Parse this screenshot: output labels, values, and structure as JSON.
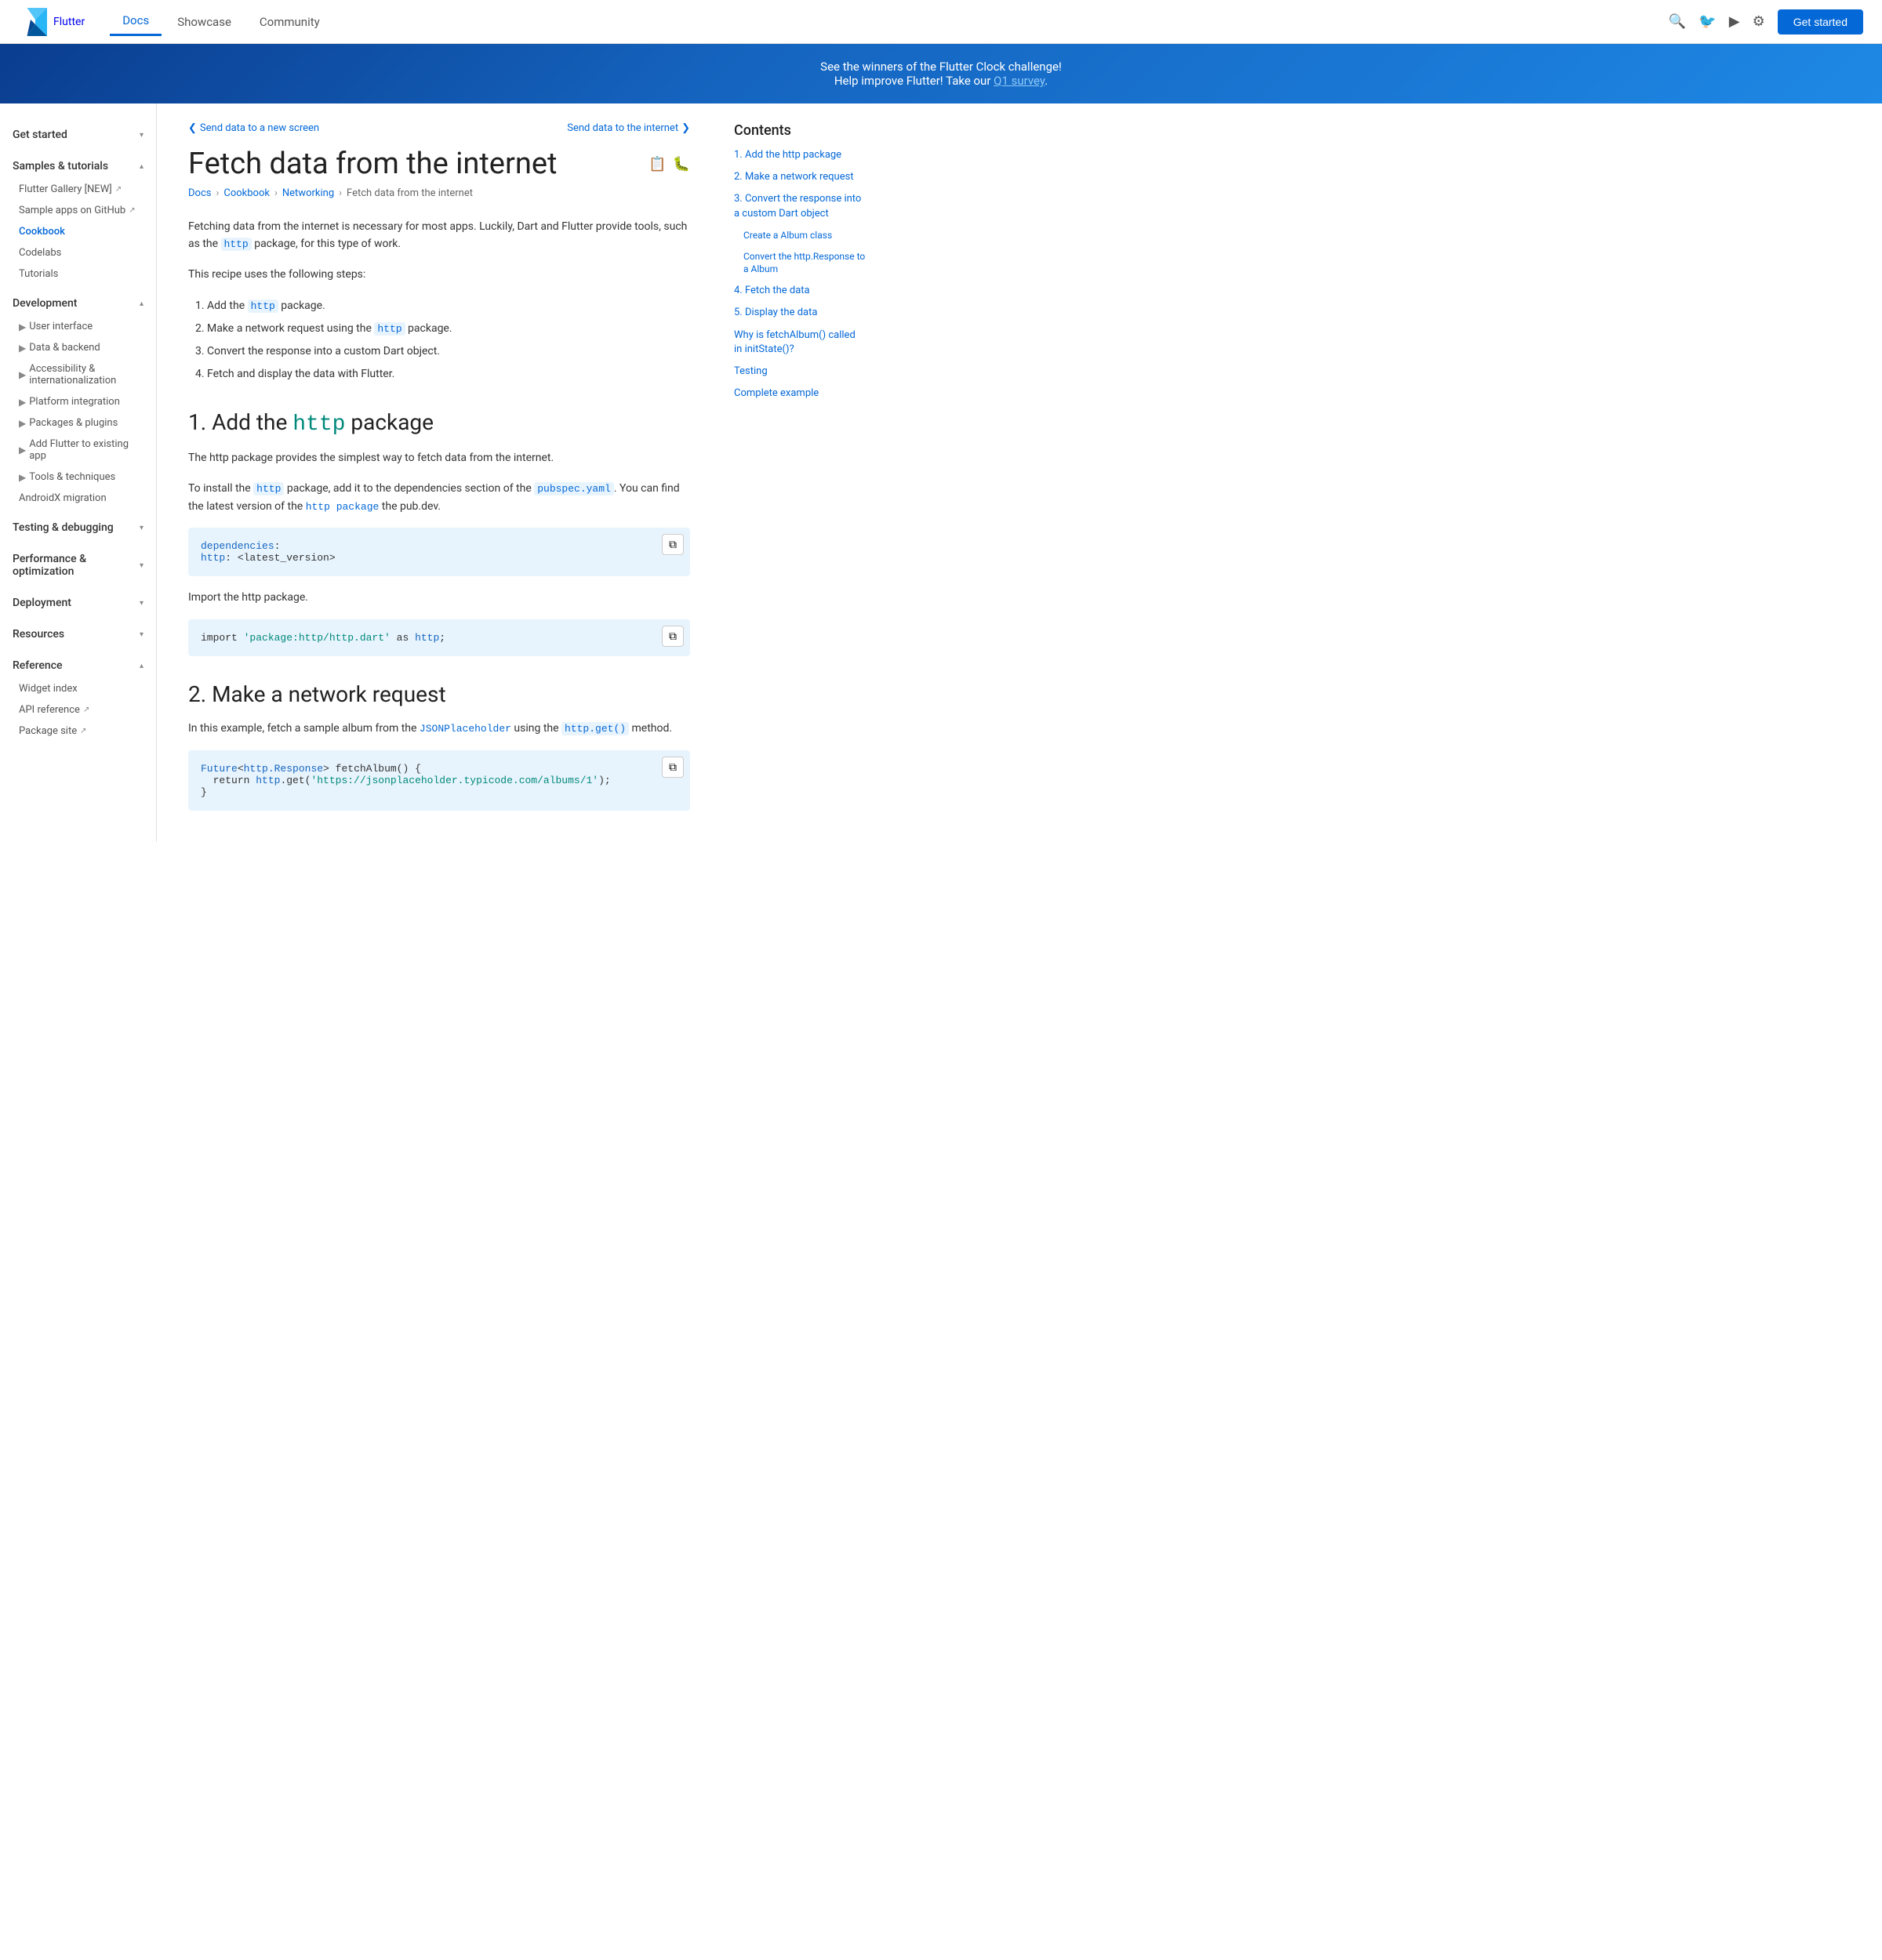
{
  "header": {
    "logo_text": "Flutter",
    "nav_items": [
      {
        "label": "Docs",
        "active": true
      },
      {
        "label": "Showcase",
        "active": false
      },
      {
        "label": "Community",
        "active": false
      }
    ],
    "get_started_label": "Get started"
  },
  "banner": {
    "line1": "See the winners of the Flutter Clock challenge!",
    "line2_prefix": "Help improve Flutter! Take our ",
    "line2_link": "Q1 survey",
    "line2_suffix": "."
  },
  "sidebar": {
    "sections": [
      {
        "label": "Get started",
        "expanded": true,
        "items": []
      },
      {
        "label": "Samples & tutorials",
        "expanded": true,
        "items": [
          {
            "label": "Flutter Gallery [NEW]",
            "external": true,
            "active": false
          },
          {
            "label": "Sample apps on GitHub",
            "external": true,
            "active": false
          },
          {
            "label": "Cookbook",
            "active": true
          },
          {
            "label": "Codelabs",
            "active": false
          },
          {
            "label": "Tutorials",
            "active": false
          }
        ]
      },
      {
        "label": "Development",
        "expanded": true,
        "items": [
          {
            "label": "User interface",
            "hasArrow": true
          },
          {
            "label": "Data & backend",
            "hasArrow": true
          },
          {
            "label": "Accessibility & internationalization",
            "hasArrow": true
          },
          {
            "label": "Platform integration",
            "hasArrow": true
          },
          {
            "label": "Packages & plugins",
            "hasArrow": true
          },
          {
            "label": "Add Flutter to existing app",
            "hasArrow": true
          },
          {
            "label": "Tools & techniques",
            "hasArrow": true
          },
          {
            "label": "AndroidX migration",
            "hasArrow": false
          }
        ]
      },
      {
        "label": "Testing & debugging",
        "expanded": false,
        "items": []
      },
      {
        "label": "Performance & optimization",
        "expanded": false,
        "items": []
      },
      {
        "label": "Deployment",
        "expanded": false,
        "items": []
      },
      {
        "label": "Resources",
        "expanded": false,
        "items": []
      },
      {
        "label": "Reference",
        "expanded": true,
        "items": [
          {
            "label": "Widget index",
            "external": false
          },
          {
            "label": "API reference",
            "external": true
          },
          {
            "label": "Package site",
            "external": true
          }
        ]
      }
    ]
  },
  "page": {
    "prev_link": "Send data to a new screen",
    "next_link": "Send data to the internet",
    "title": "Fetch data from the internet",
    "breadcrumb": [
      "Docs",
      "Cookbook",
      "Networking",
      "Fetch data from the internet"
    ],
    "intro1": "Fetching data from the internet is necessary for most apps. Luckily, Dart and Flutter provide tools, such as the http package, for this type of work.",
    "intro2": "This recipe uses the following steps:",
    "steps": [
      "Add the http package.",
      "Make a network request using the http package.",
      "Convert the response into a custom Dart object.",
      "Fetch and display the data with Flutter."
    ],
    "section1_heading_prefix": "1. Add the ",
    "section1_heading_code": "http",
    "section1_heading_suffix": " package",
    "section1_text1": "The http package provides the simplest way to fetch data from the internet.",
    "section1_text2_prefix": "To install the ",
    "section1_text2_code1": "http",
    "section1_text2_mid": " package, add it to the dependencies section of the ",
    "section1_text2_code2": "pubspec.yaml",
    "section1_text2_suffix": ". You can find the latest version of the ",
    "section1_text2_link": "http package",
    "section1_text2_end": " the pub.dev.",
    "code1_line1_key": "dependencies",
    "code1_line2_key": "  http",
    "code1_line2_val": " <latest_version>",
    "section1_text3": "Import the http package.",
    "code2_line": "import 'package:http/http.dart' as http;",
    "section2_heading": "2. Make a network request",
    "section2_text": "In this example, fetch a sample album from the JSONPlaceholder using the http.get() method.",
    "code3_line1": "Future<http.Response> fetchAlbum() {",
    "code3_line2": "  return http.get('https://jsonplaceholder.typicode.com/albums/1');",
    "code3_line3": "}"
  },
  "contents": {
    "title": "Contents",
    "items": [
      {
        "label": "1. Add the http package",
        "sub": false
      },
      {
        "label": "2. Make a network request",
        "sub": false
      },
      {
        "label": "3. Convert the response into a custom Dart object",
        "sub": false
      },
      {
        "label": "Create a Album class",
        "sub": true
      },
      {
        "label": "Convert the http.Response to a Album",
        "sub": true
      },
      {
        "label": "4. Fetch the data",
        "sub": false
      },
      {
        "label": "5. Display the data",
        "sub": false
      },
      {
        "label": "Why is fetchAlbum() called in initState()?",
        "sub": false
      },
      {
        "label": "Testing",
        "sub": false
      },
      {
        "label": "Complete example",
        "sub": false
      }
    ]
  }
}
